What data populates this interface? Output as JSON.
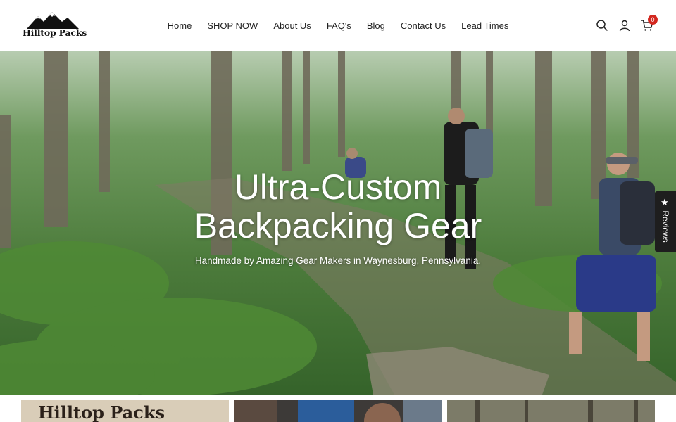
{
  "brand": {
    "logo_text": "Hilltop Packs"
  },
  "nav": {
    "items": [
      {
        "label": "Home"
      },
      {
        "label": "SHOP NOW"
      },
      {
        "label": "About Us"
      },
      {
        "label": "FAQ's"
      },
      {
        "label": "Blog"
      },
      {
        "label": "Contact Us"
      },
      {
        "label": "Lead Times"
      }
    ]
  },
  "header_icons": {
    "search": "search-icon",
    "account": "user-icon",
    "cart": "cart-icon",
    "cart_count": "0"
  },
  "hero": {
    "title_line1": "Ultra-Custom",
    "title_line2": "Backpacking Gear",
    "subtitle": "Handmade by Amazing Gear Makers in Waynesburg, Pennsylvania."
  },
  "reviews_tab": {
    "label": "Reviews",
    "icon": "star-icon"
  },
  "tiles": [
    {
      "caption": "Hilltop Packs"
    },
    {
      "caption": ""
    },
    {
      "caption": ""
    }
  ],
  "colors": {
    "badge": "#d3271f",
    "text": "#222222",
    "reviews_bg": "#1e1e1e"
  }
}
